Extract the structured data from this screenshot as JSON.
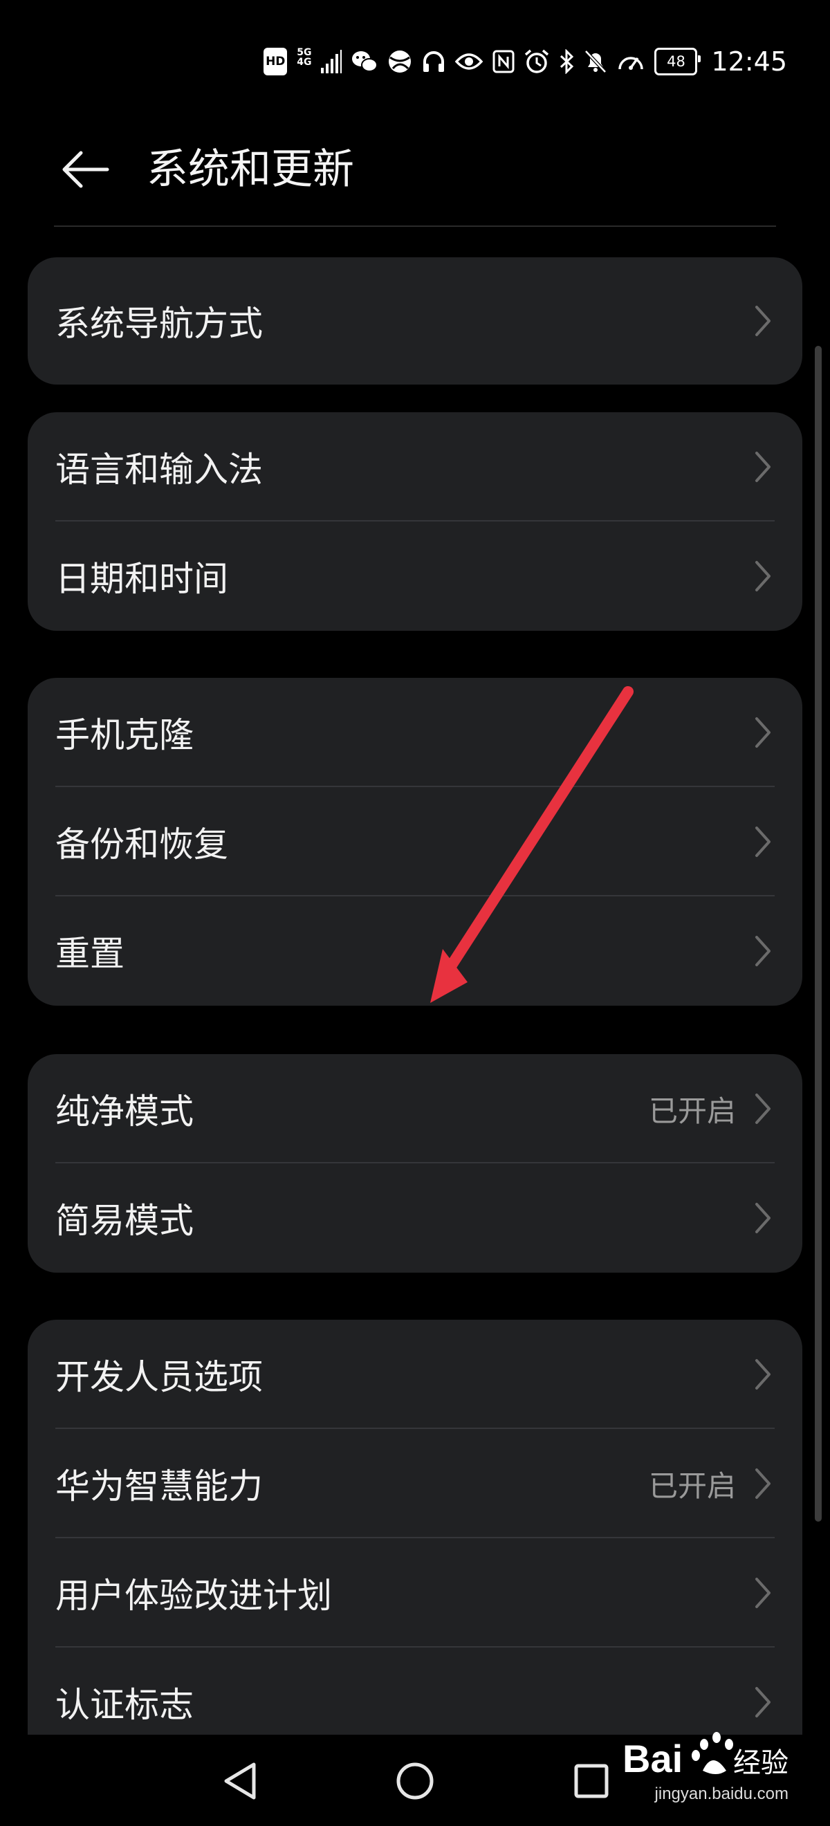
{
  "status_bar": {
    "hd": "HD",
    "network_top": "5G",
    "network_bottom": "4G",
    "battery": "48",
    "time": "12:45"
  },
  "header": {
    "title": "系统和更新"
  },
  "groups": [
    {
      "items": [
        {
          "label": "系统导航方式",
          "value": ""
        }
      ]
    },
    {
      "items": [
        {
          "label": "语言和输入法",
          "value": ""
        },
        {
          "label": "日期和时间",
          "value": ""
        }
      ]
    },
    {
      "items": [
        {
          "label": "手机克隆",
          "value": ""
        },
        {
          "label": "备份和恢复",
          "value": ""
        },
        {
          "label": "重置",
          "value": ""
        }
      ]
    },
    {
      "items": [
        {
          "label": "纯净模式",
          "value": "已开启"
        },
        {
          "label": "简易模式",
          "value": ""
        }
      ]
    },
    {
      "items": [
        {
          "label": "开发人员选项",
          "value": ""
        },
        {
          "label": "华为智慧能力",
          "value": "已开启"
        },
        {
          "label": "用户体验改进计划",
          "value": ""
        },
        {
          "label": "认证标志",
          "value": ""
        }
      ]
    }
  ],
  "watermark": {
    "brand": "Bai",
    "brand_cn": "经验",
    "url": "jingyan.baidu.com"
  },
  "colors": {
    "background": "#000000",
    "card": "#202123",
    "annotation": "#e8323f"
  }
}
